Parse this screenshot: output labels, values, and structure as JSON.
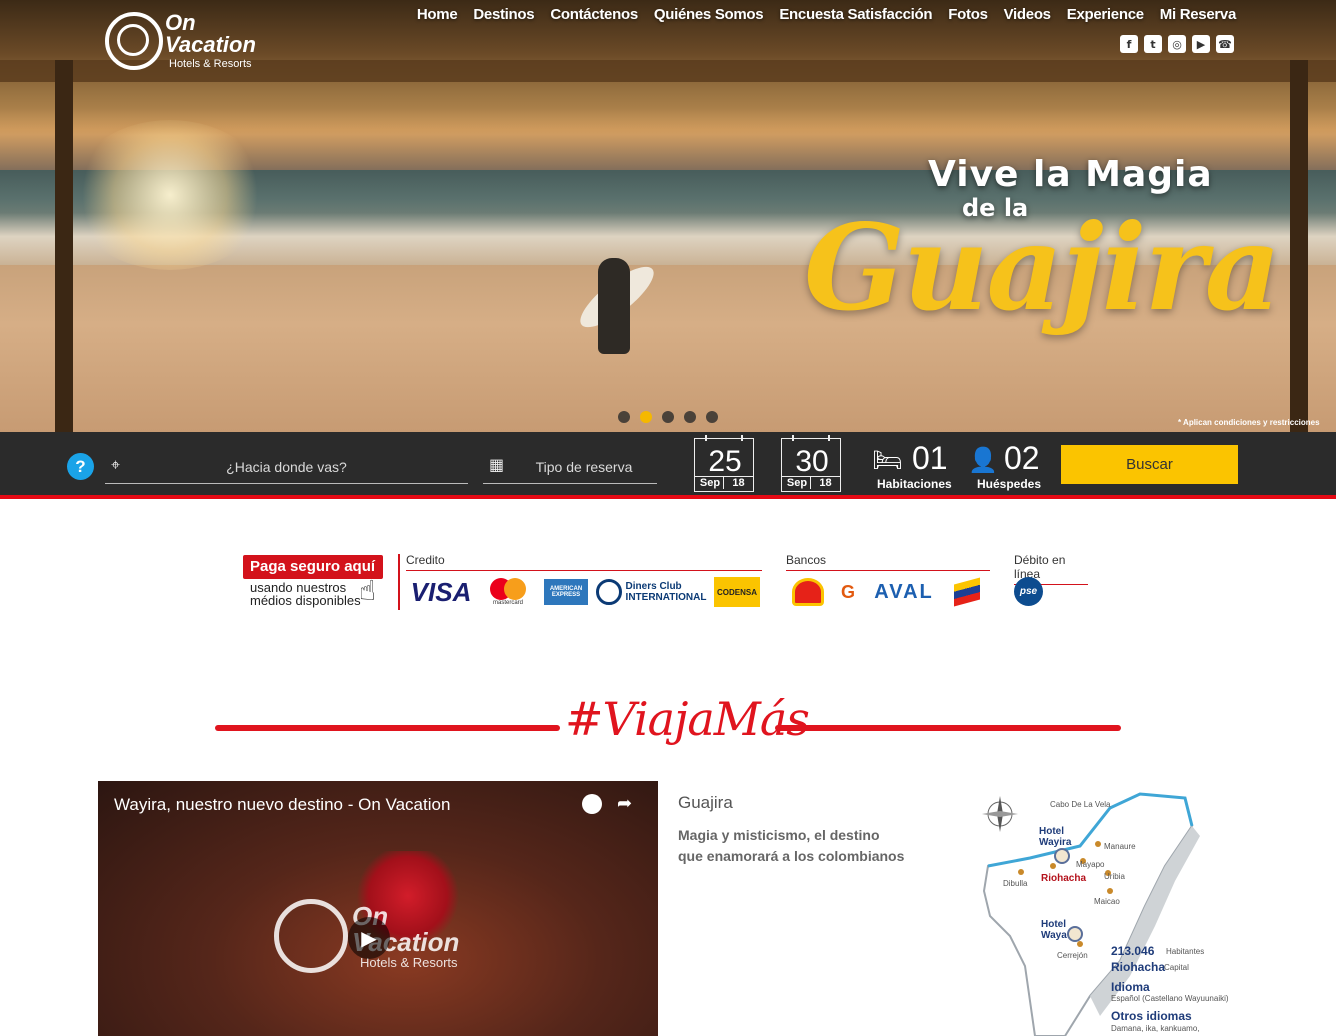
{
  "logo": {
    "name": "On Vacation",
    "tagline": "Hotels & Resorts"
  },
  "nav": [
    "Home",
    "Destinos",
    "Contáctenos",
    "Quiénes Somos",
    "Encuesta Satisfacción",
    "Fotos",
    "Videos",
    "Experience",
    "Mi Reserva"
  ],
  "social": [
    "facebook-icon",
    "twitter-icon",
    "instagram-icon",
    "youtube-icon",
    "phone-icon"
  ],
  "hero": {
    "line1": "Vive la Magia",
    "line2": "de la",
    "line3": "Guajira",
    "disclaimer": "* Aplican condiciones y restricciones",
    "slides_total": 5,
    "slide_active": 2
  },
  "search": {
    "destination_placeholder": "¿Hacia donde vas?",
    "type_placeholder": "Tipo de reserva",
    "checkin": {
      "day": "25",
      "month": "Sep",
      "year": "18"
    },
    "checkout": {
      "day": "30",
      "month": "Sep",
      "year": "18"
    },
    "rooms": {
      "count": "01",
      "label": "Habitaciones"
    },
    "guests": {
      "count": "02",
      "label": "Huéspedes"
    },
    "button": "Buscar",
    "help": "?"
  },
  "payments": {
    "badge": "Paga seguro aquí",
    "subtitle": "usando nuestros médios disponibles",
    "credit_title": "Credito",
    "credit": [
      "VISA",
      "mastercard",
      "AMERICAN EXPRESS",
      "Diners Club INTERNATIONAL",
      "CODENSA"
    ],
    "banks_title": "Bancos",
    "banks": [
      "Banco Caja Social",
      "Banco de Bogotá",
      "Grupo AVAL",
      "Bancolombia"
    ],
    "debit_title": "Débito en línea",
    "debit": [
      "pse"
    ]
  },
  "section_title": "#ViajaMás",
  "video": {
    "title": "Wayira, nuestro nuevo destino - On Vacation",
    "logo_name": "On Vacation",
    "logo_sub": "Hotels & Resorts"
  },
  "destination": {
    "name": "Guajira",
    "description": "Magia y misticismo, el destino que enamorará a los colombianos"
  },
  "map": {
    "places": [
      "Cabo De La Vela",
      "Manaure",
      "Mayapo",
      "Uribia",
      "Maicao",
      "Dibulla",
      "Cerrejón"
    ],
    "hotel1": "Hotel Wayira",
    "city": "Riohacha",
    "hotel2": "Hotel Waya",
    "population": "213.046",
    "population_label": "Habitantes",
    "capital": "Riohacha",
    "capital_label": "Capital",
    "language_title": "Idioma",
    "language": "Español (Castellano Wayuunaiki)",
    "other_languages_title": "Otros idiomas",
    "other_languages": "Damana, ika, kankuamo,"
  },
  "colors": {
    "accent_red": "#e0141e",
    "button_yellow": "#fbc400",
    "title_yellow": "#f6c21b",
    "help_blue": "#1aa3e8"
  }
}
